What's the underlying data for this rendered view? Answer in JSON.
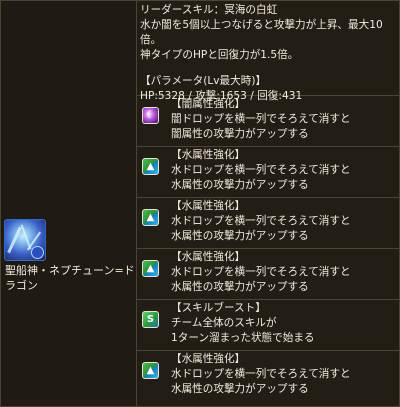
{
  "monster": {
    "name": "聖船神・ネプチューン=ドラゴン"
  },
  "info": {
    "leader_skill_title": "リーダースキル：冥海の白虹",
    "leader_skill_line1": "水か闇を5個以上つなげると攻撃力が上昇、最大10倍。",
    "leader_skill_line2": "神タイプのHPと回復力が1.5倍。",
    "param_title": "【パラメータ(Lv最大時)】",
    "param_values": "HP:5328 / 攻撃:1653 / 回復:431"
  },
  "awakenings": [
    {
      "icon": "dark-row-enhance-icon",
      "title": "【闇属性強化】",
      "line1": "闇ドロップを横一列でそろえて消すと",
      "line2": "闇属性の攻撃力がアップする"
    },
    {
      "icon": "water-row-enhance-icon",
      "title": "【水属性強化】",
      "line1": "水ドロップを横一列でそろえて消すと",
      "line2": "水属性の攻撃力がアップする"
    },
    {
      "icon": "water-row-enhance-icon",
      "title": "【水属性強化】",
      "line1": "水ドロップを横一列でそろえて消すと",
      "line2": "水属性の攻撃力がアップする"
    },
    {
      "icon": "water-row-enhance-icon",
      "title": "【水属性強化】",
      "line1": "水ドロップを横一列でそろえて消すと",
      "line2": "水属性の攻撃力がアップする"
    },
    {
      "icon": "skill-boost-icon",
      "title": "【スキルブースト】",
      "line1": "チーム全体のスキルが",
      "line2": "1ターン溜まった状態で始まる"
    },
    {
      "icon": "water-row-enhance-icon",
      "title": "【水属性強化】",
      "line1": "水ドロップを横一列でそろえて消すと",
      "line2": "水属性の攻撃力がアップする"
    }
  ]
}
